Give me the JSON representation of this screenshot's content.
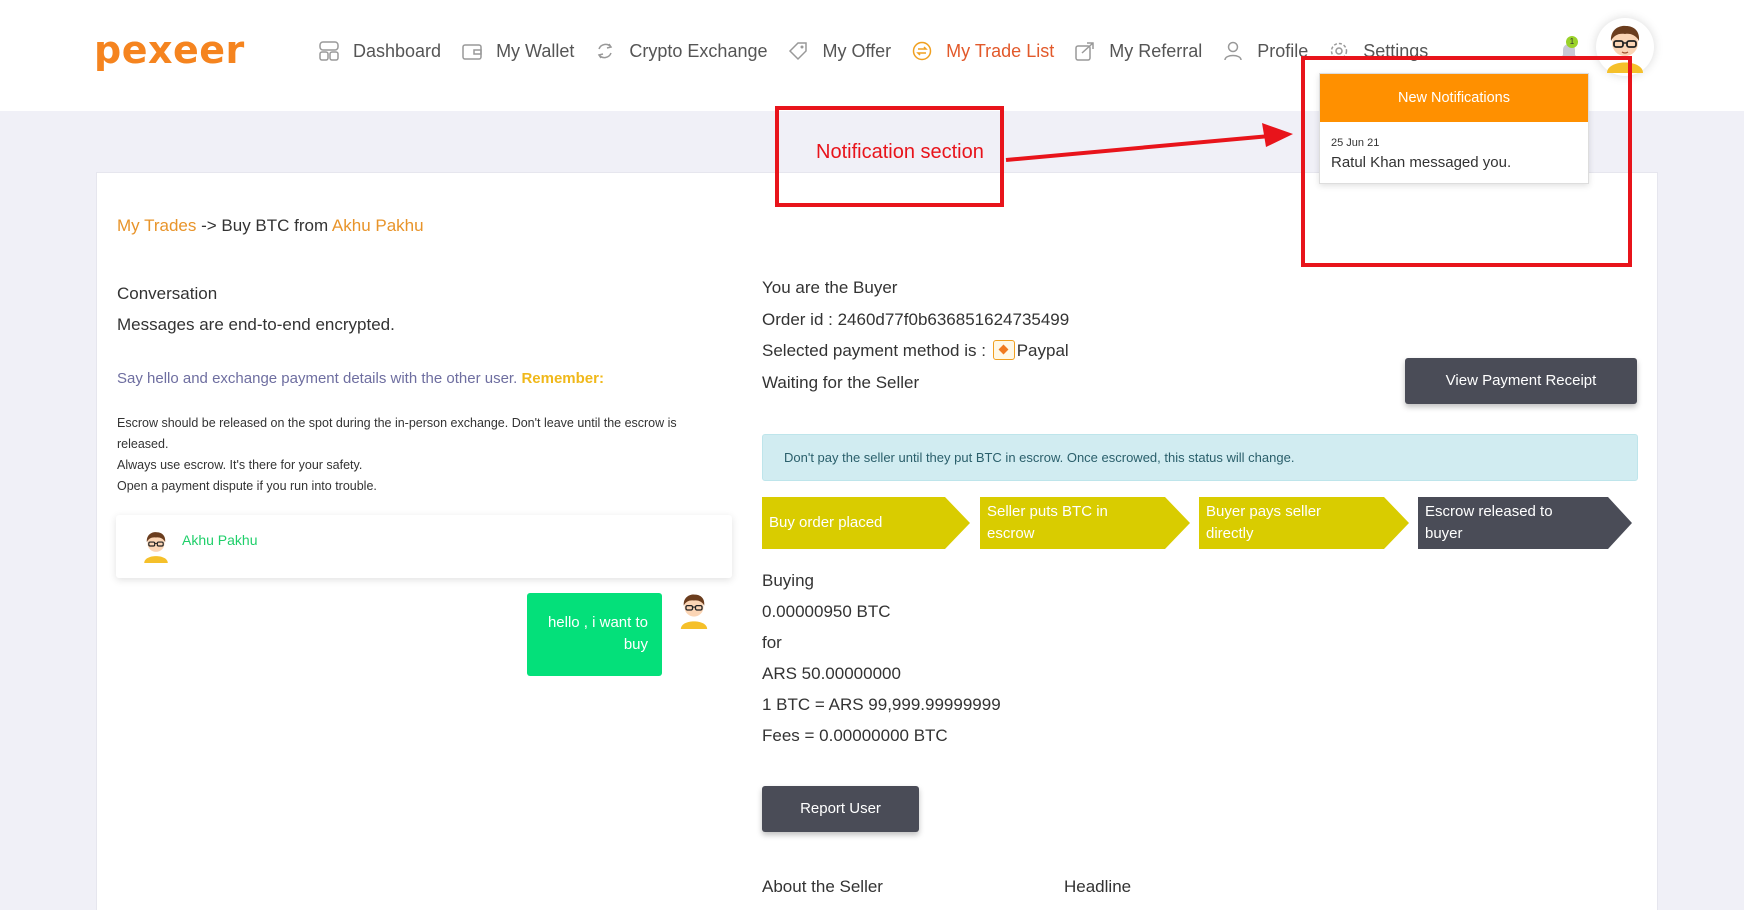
{
  "header": {
    "logo": "pexeer",
    "nav": [
      {
        "label": "Dashboard",
        "icon": "dashboard-icon"
      },
      {
        "label": "My Wallet",
        "icon": "wallet-icon"
      },
      {
        "label": "Crypto Exchange",
        "icon": "exchange-icon"
      },
      {
        "label": "My Offer",
        "icon": "offer-tag-icon"
      },
      {
        "label": "My Trade List",
        "icon": "trade-list-icon",
        "active": true
      },
      {
        "label": "My Referral",
        "icon": "referral-share-icon"
      },
      {
        "label": "Profile",
        "icon": "user-icon"
      },
      {
        "label": "Settings",
        "icon": "gear-icon"
      }
    ],
    "notification_count": "1",
    "active_color": "#e2592a"
  },
  "breadcrumb": {
    "link": "My Trades",
    "middle": " -> Buy BTC from ",
    "seller": "Akhu Pakhu"
  },
  "conversation": {
    "title": "Conversation",
    "subtitle": "Messages are end-to-end encrypted.",
    "hello_text": "Say hello and exchange payment details with the other user.",
    "remember_label": "Remember:",
    "notes": [
      "Escrow should be released on the spot during the in-person exchange. Don't leave until the escrow is released.",
      "Always use escrow. It's there for your safety.",
      "Open a payment dispute if you run into trouble."
    ],
    "partner_name": "Akhu Pakhu",
    "message": "hello , i want to buy"
  },
  "order": {
    "role": "You are the Buyer",
    "order_id": "Order id : 2460d77f0b636851624735499",
    "payment_method_label": "Selected payment method is :",
    "payment_method": "Paypal",
    "status": "Waiting for the Seller",
    "view_receipt_button": "View Payment Receipt",
    "alert": "Don't pay the seller until they put BTC in escrow. Once escrowed, this status will change.",
    "steps": [
      {
        "label": "Buy order placed",
        "color": "#d9cc00"
      },
      {
        "label": "Seller puts BTC in escrow",
        "color": "#d9cc00"
      },
      {
        "label": "Buyer pays seller directly",
        "color": "#d9cc00"
      },
      {
        "label": "Escrow released to buyer",
        "color": "#4a4c57"
      }
    ],
    "buying_label": "Buying",
    "btc_amount": "0.00000950 BTC",
    "for_label": "for",
    "fiat_amount": "ARS 50.00000000",
    "rate": "1 BTC = ARS 99,999.99999999",
    "fees": "Fees = 0.00000000 BTC",
    "report_button": "Report User",
    "about_seller": "About the Seller",
    "headline": "Headline"
  },
  "notifications": {
    "header": "New Notifications",
    "items": [
      {
        "date": "25 Jun 21",
        "message": "Ratul Khan messaged you."
      }
    ]
  },
  "annotation": {
    "label": "Notification section",
    "color": "#e8141b"
  }
}
